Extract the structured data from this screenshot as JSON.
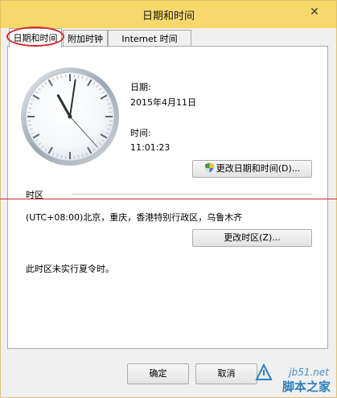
{
  "window": {
    "title": "日期和时间"
  },
  "tabs": [
    {
      "label": "日期和时间",
      "active": true
    },
    {
      "label": "附加时钟",
      "active": false
    },
    {
      "label": "Internet 时间",
      "active": false
    }
  ],
  "clock": {
    "hour": 11,
    "minute": 1,
    "second": 23
  },
  "datetime": {
    "date_label": "日期:",
    "date_value": "2015年4月11日",
    "time_label": "时间:",
    "time_value": "11:01:23",
    "change_button": "更改日期和时间(D)..."
  },
  "timezone": {
    "section_title": "时区",
    "value": "(UTC+08:00)北京，重庆，香港特别行政区，乌鲁木齐",
    "change_button": "更改时区(Z)...",
    "dst_note": "此时区未实行夏令时。"
  },
  "footer": {
    "ok_button": "确定",
    "cancel_button": "取消"
  },
  "watermark": {
    "site": "jb51.net",
    "brand": "脚本之家"
  },
  "colors": {
    "title_bar": "#f6d86b",
    "highlight": "#d8262a"
  }
}
